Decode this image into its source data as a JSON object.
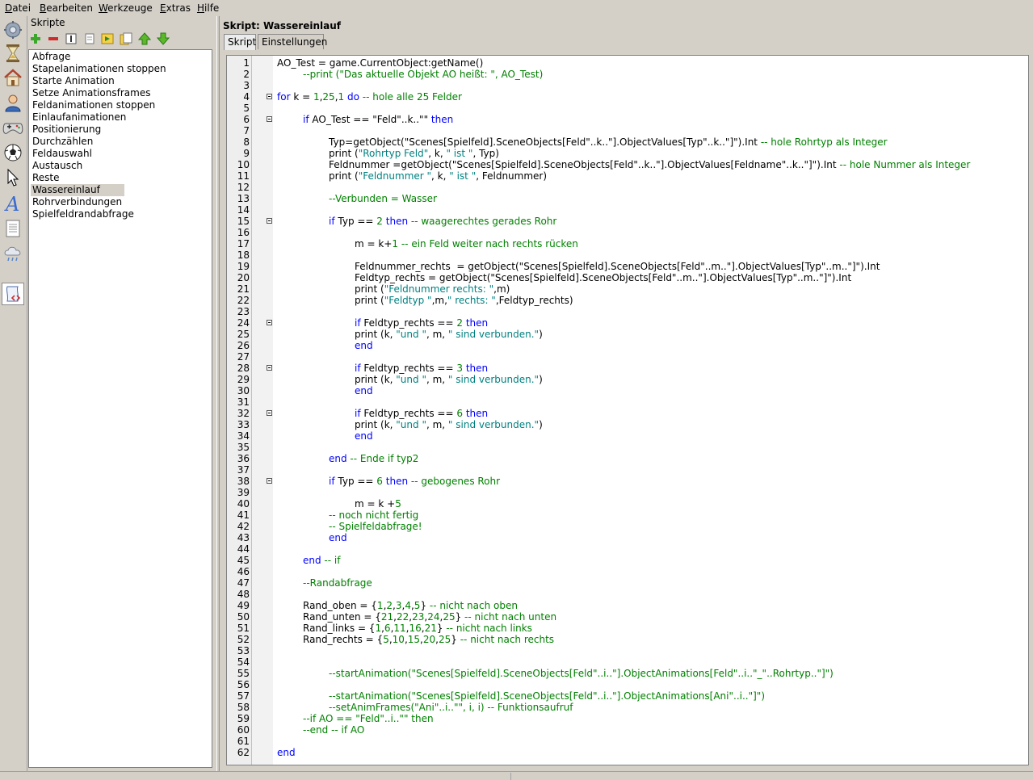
{
  "menu": [
    "Datei",
    "Bearbeiten",
    "Werkzeuge",
    "Extras",
    "Hilfe"
  ],
  "sidebar_icons": [
    "settings-icon",
    "hourglass-icon",
    "house-icon",
    "person-icon",
    "gamepad-icon",
    "ball-icon",
    "pointer-icon",
    "text-icon",
    "document-icon",
    "weather-icon",
    "script-icon"
  ],
  "left_panel": {
    "title": "Skripte",
    "toolbar": [
      "add-icon",
      "remove-icon",
      "rename-icon",
      "list-icon",
      "run-icon",
      "copy-icon",
      "move-up-icon",
      "move-down-icon"
    ],
    "items": [
      "Abfrage",
      "Stapelanimationen stoppen",
      "Starte Animation",
      "Setze Animationsframes",
      "Feldanimationen stoppen",
      "Einlaufanimationen",
      "Positionierung",
      "Durchzählen",
      "Feldauswahl",
      "Austausch",
      "Reste",
      "Wassereinlauf",
      "Rohrverbindungen",
      "Spielfeldrandabfrage"
    ],
    "selected": "Wassereinlauf"
  },
  "right_panel": {
    "title": "Skript: Wassereinlauf",
    "tabs": [
      "Skript",
      "Einstellungen"
    ],
    "active_tab": "Skript"
  },
  "code_lines": [
    {
      "n": "1",
      "fold": false,
      "ind": 0,
      "t": [
        [
          "AO_Test = game.CurrentObject:getName()",
          ""
        ]
      ]
    },
    {
      "n": "2",
      "fold": false,
      "ind": 1,
      "t": [
        [
          "--print (\"Das aktuelle Objekt AO heißt: \", AO_Test)",
          "cm"
        ]
      ]
    },
    {
      "n": "3",
      "fold": false,
      "ind": 0,
      "t": []
    },
    {
      "n": "4",
      "fold": true,
      "ind": 0,
      "t": [
        [
          "for",
          "kw"
        ],
        [
          " k = ",
          ""
        ],
        [
          "1",
          "nm"
        ],
        [
          ",",
          ""
        ],
        [
          "25",
          "nm"
        ],
        [
          ",",
          ""
        ],
        [
          "1",
          "nm"
        ],
        [
          " ",
          ""
        ],
        [
          "do",
          "kw"
        ],
        [
          " -- hole alle 25 Felder",
          "cm"
        ]
      ]
    },
    {
      "n": "5",
      "fold": false,
      "ind": 0,
      "t": []
    },
    {
      "n": "6",
      "fold": true,
      "ind": 1,
      "t": [
        [
          "if",
          "kw"
        ],
        [
          " AO_Test == ",
          ""
        ],
        [
          "\"Feld\"",
          ""
        ],
        [
          "..k..",
          ""
        ],
        [
          "\"\"",
          ""
        ],
        [
          " ",
          ""
        ],
        [
          "then",
          "kw"
        ]
      ]
    },
    {
      "n": "7",
      "fold": false,
      "ind": 0,
      "t": []
    },
    {
      "n": "8",
      "fold": false,
      "ind": 2,
      "t": [
        [
          "Typ=getObject(",
          ""
        ],
        [
          "\"Scenes[Spielfeld].SceneObjects[Feld\"",
          ""
        ],
        [
          "..k..",
          ""
        ],
        [
          "\"].ObjectValues[Typ\"",
          ""
        ],
        [
          "..k..",
          ""
        ],
        [
          "\"]\"",
          ""
        ],
        [
          ").Int ",
          ""
        ],
        [
          "-- hole Rohrtyp als Integer",
          "cm"
        ]
      ]
    },
    {
      "n": "9",
      "fold": false,
      "ind": 2,
      "t": [
        [
          "print (",
          ""
        ],
        [
          "\"Rohrtyp Feld\"",
          "st"
        ],
        [
          ", k, ",
          ""
        ],
        [
          "\" ist \"",
          "st"
        ],
        [
          ", Typ)",
          ""
        ]
      ]
    },
    {
      "n": "10",
      "fold": false,
      "ind": 2,
      "t": [
        [
          "Feldnummer =getObject(",
          ""
        ],
        [
          "\"Scenes[Spielfeld].SceneObjects[Feld\"",
          ""
        ],
        [
          "..k..",
          ""
        ],
        [
          "\"].ObjectValues[Feldname\"",
          ""
        ],
        [
          "..k..",
          ""
        ],
        [
          "\"]\"",
          ""
        ],
        [
          ").Int ",
          ""
        ],
        [
          "-- hole Nummer als Integer",
          "cm"
        ]
      ]
    },
    {
      "n": "11",
      "fold": false,
      "ind": 2,
      "t": [
        [
          "print (",
          ""
        ],
        [
          "\"Feldnummer \"",
          "st"
        ],
        [
          ", k, ",
          ""
        ],
        [
          "\" ist \"",
          "st"
        ],
        [
          ", Feldnummer)",
          ""
        ]
      ]
    },
    {
      "n": "12",
      "fold": false,
      "ind": 0,
      "t": []
    },
    {
      "n": "13",
      "fold": false,
      "ind": 2,
      "t": [
        [
          "--Verbunden = Wasser",
          "cm"
        ]
      ]
    },
    {
      "n": "14",
      "fold": false,
      "ind": 0,
      "t": []
    },
    {
      "n": "15",
      "fold": true,
      "ind": 2,
      "t": [
        [
          "if",
          "kw"
        ],
        [
          " Typ == ",
          ""
        ],
        [
          "2",
          "nm"
        ],
        [
          " ",
          ""
        ],
        [
          "then",
          "kw"
        ],
        [
          " -- waagerechtes gerades Rohr",
          "cm"
        ]
      ]
    },
    {
      "n": "16",
      "fold": false,
      "ind": 0,
      "t": []
    },
    {
      "n": "17",
      "fold": false,
      "ind": 3,
      "t": [
        [
          "m = k+",
          ""
        ],
        [
          "1",
          "nm"
        ],
        [
          " -- ein Feld weiter nach rechts rücken",
          "cm"
        ]
      ]
    },
    {
      "n": "18",
      "fold": false,
      "ind": 0,
      "t": []
    },
    {
      "n": "19",
      "fold": false,
      "ind": 3,
      "t": [
        [
          "Feldnummer_rechts  = getObject(",
          ""
        ],
        [
          "\"Scenes[Spielfeld].SceneObjects[Feld\"",
          ""
        ],
        [
          "..m..",
          ""
        ],
        [
          "\"].ObjectValues[Typ\"",
          ""
        ],
        [
          "..m..",
          ""
        ],
        [
          "\"]\"",
          ""
        ],
        [
          ").Int",
          ""
        ]
      ]
    },
    {
      "n": "20",
      "fold": false,
      "ind": 3,
      "t": [
        [
          "Feldtyp_rechts = getObject(",
          ""
        ],
        [
          "\"Scenes[Spielfeld].SceneObjects[Feld\"",
          ""
        ],
        [
          "..m..",
          ""
        ],
        [
          "\"].ObjectValues[Typ\"",
          ""
        ],
        [
          "..m..",
          ""
        ],
        [
          "\"]\"",
          ""
        ],
        [
          ").Int",
          ""
        ]
      ]
    },
    {
      "n": "21",
      "fold": false,
      "ind": 3,
      "t": [
        [
          "print (",
          ""
        ],
        [
          "\"Feldnummer rechts: \"",
          "st"
        ],
        [
          ",m)",
          ""
        ]
      ]
    },
    {
      "n": "22",
      "fold": false,
      "ind": 3,
      "t": [
        [
          "print (",
          ""
        ],
        [
          "\"Feldtyp \"",
          "st"
        ],
        [
          ",m,",
          ""
        ],
        [
          "\" rechts: \"",
          "st"
        ],
        [
          ",Feldtyp_rechts)",
          ""
        ]
      ]
    },
    {
      "n": "23",
      "fold": false,
      "ind": 0,
      "t": []
    },
    {
      "n": "24",
      "fold": true,
      "ind": 3,
      "t": [
        [
          "if",
          "kw"
        ],
        [
          " Feldtyp_rechts == ",
          ""
        ],
        [
          "2",
          "nm"
        ],
        [
          " ",
          ""
        ],
        [
          "then",
          "kw"
        ]
      ]
    },
    {
      "n": "25",
      "fold": false,
      "ind": 3,
      "t": [
        [
          "print (k, ",
          ""
        ],
        [
          "\"und \"",
          "st"
        ],
        [
          ", m, ",
          ""
        ],
        [
          "\" sind verbunden.\"",
          "st"
        ],
        [
          ")",
          ""
        ]
      ]
    },
    {
      "n": "26",
      "fold": false,
      "ind": 3,
      "t": [
        [
          "end",
          "kw"
        ]
      ]
    },
    {
      "n": "27",
      "fold": false,
      "ind": 0,
      "t": []
    },
    {
      "n": "28",
      "fold": true,
      "ind": 3,
      "t": [
        [
          "if",
          "kw"
        ],
        [
          " Feldtyp_rechts == ",
          ""
        ],
        [
          "3",
          "nm"
        ],
        [
          " ",
          ""
        ],
        [
          "then",
          "kw"
        ]
      ]
    },
    {
      "n": "29",
      "fold": false,
      "ind": 3,
      "t": [
        [
          "print (k, ",
          ""
        ],
        [
          "\"und \"",
          "st"
        ],
        [
          ", m, ",
          ""
        ],
        [
          "\" sind verbunden.\"",
          "st"
        ],
        [
          ")",
          ""
        ]
      ]
    },
    {
      "n": "30",
      "fold": false,
      "ind": 3,
      "t": [
        [
          "end",
          "kw"
        ]
      ]
    },
    {
      "n": "31",
      "fold": false,
      "ind": 0,
      "t": []
    },
    {
      "n": "32",
      "fold": true,
      "ind": 3,
      "t": [
        [
          "if",
          "kw"
        ],
        [
          " Feldtyp_rechts == ",
          ""
        ],
        [
          "6",
          "nm"
        ],
        [
          " ",
          ""
        ],
        [
          "then",
          "kw"
        ]
      ]
    },
    {
      "n": "33",
      "fold": false,
      "ind": 3,
      "t": [
        [
          "print (k, ",
          ""
        ],
        [
          "\"und \"",
          "st"
        ],
        [
          ", m, ",
          ""
        ],
        [
          "\" sind verbunden.\"",
          "st"
        ],
        [
          ")",
          ""
        ]
      ]
    },
    {
      "n": "34",
      "fold": false,
      "ind": 3,
      "t": [
        [
          "end",
          "kw"
        ]
      ]
    },
    {
      "n": "35",
      "fold": false,
      "ind": 0,
      "t": []
    },
    {
      "n": "36",
      "fold": false,
      "ind": 2,
      "t": [
        [
          "end",
          "kw"
        ],
        [
          " -- Ende if typ2",
          "cm"
        ]
      ]
    },
    {
      "n": "37",
      "fold": false,
      "ind": 0,
      "t": []
    },
    {
      "n": "38",
      "fold": true,
      "ind": 2,
      "t": [
        [
          "if",
          "kw"
        ],
        [
          " Typ == ",
          ""
        ],
        [
          "6",
          "nm"
        ],
        [
          " ",
          ""
        ],
        [
          "then",
          "kw"
        ],
        [
          " -- gebogenes Rohr",
          "cm"
        ]
      ]
    },
    {
      "n": "39",
      "fold": false,
      "ind": 0,
      "t": []
    },
    {
      "n": "40",
      "fold": false,
      "ind": 3,
      "t": [
        [
          "m = k +",
          ""
        ],
        [
          "5",
          "nm"
        ]
      ]
    },
    {
      "n": "41",
      "fold": false,
      "ind": 2,
      "t": [
        [
          "-- noch nicht fertig",
          "cm"
        ]
      ]
    },
    {
      "n": "42",
      "fold": false,
      "ind": 2,
      "t": [
        [
          "-- Spielfeldabfrage!",
          "cm"
        ]
      ]
    },
    {
      "n": "43",
      "fold": false,
      "ind": 2,
      "t": [
        [
          "end",
          "kw"
        ]
      ]
    },
    {
      "n": "44",
      "fold": false,
      "ind": 0,
      "t": []
    },
    {
      "n": "45",
      "fold": false,
      "ind": 1,
      "t": [
        [
          "end",
          "kw"
        ],
        [
          " -- if",
          "cm"
        ]
      ]
    },
    {
      "n": "46",
      "fold": false,
      "ind": 0,
      "t": []
    },
    {
      "n": "47",
      "fold": false,
      "ind": 1,
      "t": [
        [
          "--Randabfrage",
          "cm"
        ]
      ]
    },
    {
      "n": "48",
      "fold": false,
      "ind": 0,
      "t": []
    },
    {
      "n": "49",
      "fold": false,
      "ind": 1,
      "t": [
        [
          "Rand_oben = {",
          ""
        ],
        [
          "1",
          "nm"
        ],
        [
          ",",
          ""
        ],
        [
          "2",
          "nm"
        ],
        [
          ",",
          ""
        ],
        [
          "3",
          "nm"
        ],
        [
          ",",
          ""
        ],
        [
          "4",
          "nm"
        ],
        [
          ",",
          ""
        ],
        [
          "5",
          "nm"
        ],
        [
          "} ",
          ""
        ],
        [
          "-- nicht nach oben",
          "cm"
        ]
      ]
    },
    {
      "n": "50",
      "fold": false,
      "ind": 1,
      "t": [
        [
          "Rand_unten = {",
          ""
        ],
        [
          "21",
          "nm"
        ],
        [
          ",",
          ""
        ],
        [
          "22",
          "nm"
        ],
        [
          ",",
          ""
        ],
        [
          "23",
          "nm"
        ],
        [
          ",",
          ""
        ],
        [
          "24",
          "nm"
        ],
        [
          ",",
          ""
        ],
        [
          "25",
          "nm"
        ],
        [
          "} ",
          ""
        ],
        [
          "-- nicht nach unten",
          "cm"
        ]
      ]
    },
    {
      "n": "51",
      "fold": false,
      "ind": 1,
      "t": [
        [
          "Rand_links = {",
          ""
        ],
        [
          "1",
          "nm"
        ],
        [
          ",",
          ""
        ],
        [
          "6",
          "nm"
        ],
        [
          ",",
          ""
        ],
        [
          "11",
          "nm"
        ],
        [
          ",",
          ""
        ],
        [
          "16",
          "nm"
        ],
        [
          ",",
          ""
        ],
        [
          "21",
          "nm"
        ],
        [
          "} ",
          ""
        ],
        [
          "-- nicht nach links",
          "cm"
        ]
      ]
    },
    {
      "n": "52",
      "fold": false,
      "ind": 1,
      "t": [
        [
          "Rand_rechts = {",
          ""
        ],
        [
          "5",
          "nm"
        ],
        [
          ",",
          ""
        ],
        [
          "10",
          "nm"
        ],
        [
          ",",
          ""
        ],
        [
          "15",
          "nm"
        ],
        [
          ",",
          ""
        ],
        [
          "20",
          "nm"
        ],
        [
          ",",
          ""
        ],
        [
          "25",
          "nm"
        ],
        [
          "} ",
          ""
        ],
        [
          "-- nicht nach rechts",
          "cm"
        ]
      ]
    },
    {
      "n": "53",
      "fold": false,
      "ind": 0,
      "t": []
    },
    {
      "n": "54",
      "fold": false,
      "ind": 0,
      "t": []
    },
    {
      "n": "55",
      "fold": false,
      "ind": 2,
      "t": [
        [
          "--startAnimation(\"Scenes[Spielfeld].SceneObjects[Feld\"..i..\"].ObjectAnimations[Feld\"..i..\"_\"..Rohrtyp..\"]\")",
          "cm"
        ]
      ]
    },
    {
      "n": "56",
      "fold": false,
      "ind": 0,
      "t": []
    },
    {
      "n": "57",
      "fold": false,
      "ind": 2,
      "t": [
        [
          "--startAnimation(\"Scenes[Spielfeld].SceneObjects[Feld\"..i..\"].ObjectAnimations[Ani\"..i..\"]\")",
          "cm"
        ]
      ]
    },
    {
      "n": "58",
      "fold": false,
      "ind": 2,
      "t": [
        [
          "--setAnimFrames(\"Ani\"..i..\"\", i, i) -- Funktionsaufruf",
          "cm"
        ]
      ]
    },
    {
      "n": "59",
      "fold": false,
      "ind": 1,
      "t": [
        [
          "--if AO == \"Feld\"..i..\"\" then",
          "cm"
        ]
      ]
    },
    {
      "n": "60",
      "fold": false,
      "ind": 1,
      "t": [
        [
          "--end -- if AO",
          "cm"
        ]
      ]
    },
    {
      "n": "61",
      "fold": false,
      "ind": 0,
      "t": []
    },
    {
      "n": "62",
      "fold": false,
      "ind": 0,
      "t": [
        [
          "end",
          "kw"
        ]
      ]
    }
  ]
}
